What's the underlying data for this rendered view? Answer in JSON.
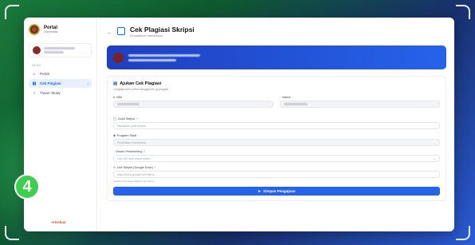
{
  "sidebar": {
    "brand_title": "Portal",
    "brand_subtitle": "Universitas",
    "menu_label": "MENU",
    "items": [
      {
        "label": "Portal",
        "icon": "home-icon",
        "active": false
      },
      {
        "label": "Cek Plagiasi",
        "icon": "document-icon",
        "active": true
      },
      {
        "label": "Tracer Study",
        "icon": "search-icon",
        "active": false
      }
    ],
    "logout_label": "Keluar"
  },
  "badge_number": "4",
  "header": {
    "title": "Cek Plagiasi Skripsi",
    "subtitle": "Pendaftaran mahasiswa"
  },
  "form": {
    "title": "Ajukan Cek Plagiasi",
    "subtitle": "Lengkapi form untuk mengajukan uji plagiasi.",
    "nim_label": "NIM",
    "nama_label": "Nama",
    "judul_label": "Judul Skripsi",
    "judul_placeholder": "Masukkan judul skripsi...",
    "prodi_label": "Program Studi",
    "prodi_value": "Pendidikan mahasiswa",
    "dosen_label": "Dosen Pembimbing",
    "dosen_placeholder": "Cari NID atau nama dosen...",
    "link_label": "Link Skripsi (Google Drive)",
    "link_placeholder": "https://drive.google.com/file/d/...",
    "link_note": "Pastikan link dapat diakses oleh admin.",
    "submit_label": "Simpan Pengajuan"
  },
  "colors": {
    "accent": "#2563eb",
    "badge": "#3fcf4f",
    "logout": "#d94a2b"
  }
}
